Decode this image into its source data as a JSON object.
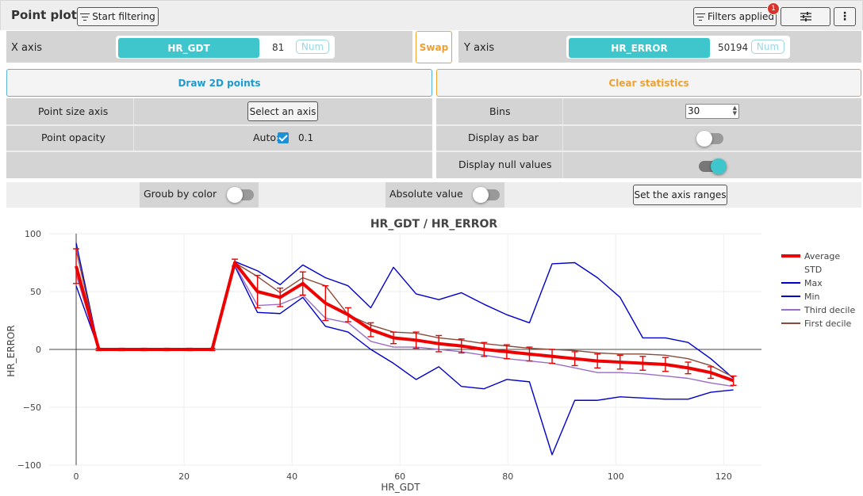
{
  "header": {
    "title": "Point plot",
    "start_filtering": "Start filtering",
    "filters_applied": "Filters applied",
    "filters_badge": "1",
    "more": "⋮"
  },
  "x_axis": {
    "label": "X axis",
    "field": "HR_GDT",
    "count": "81",
    "type": "Num"
  },
  "swap_label": "Swap",
  "y_axis": {
    "label": "Y axis",
    "field": "HR_ERROR",
    "count": "50194",
    "type": "Num"
  },
  "left_panel": {
    "draw_button": "Draw 2D points",
    "point_size_label": "Point size axis",
    "select_axis_button": "Select an axis",
    "point_opacity_label": "Point opacity",
    "auto_label": "Auto:",
    "opacity_value": "0.1"
  },
  "right_panel": {
    "clear_button": "Clear statistics",
    "bins_label": "Bins",
    "bins_value": "30",
    "display_bar_label": "Display as bar",
    "display_null_label": "Display null values"
  },
  "options": {
    "group_by_color": "Groub by color",
    "absolute_value": "Absolute value",
    "set_axis_ranges": "Set the axis ranges"
  },
  "colors": {
    "accent": "#3fc6cc",
    "swap": "#f0a030",
    "draw": "#1e9ad0",
    "average": "#ee0000",
    "extreme": "#0000cc",
    "third_decile": "#9a6ec8",
    "first_decile": "#8b4a3a"
  },
  "chart_data": {
    "type": "line",
    "title": "HR_GDT / HR_ERROR",
    "xlabel": "HR_GDT",
    "ylabel": "HR_ERROR",
    "xlim": [
      -5,
      127
    ],
    "ylim": [
      -100,
      100
    ],
    "x_ticks": [
      0,
      20,
      40,
      60,
      80,
      100,
      120
    ],
    "y_ticks": [
      -100,
      -50,
      0,
      50,
      100
    ],
    "y_tick_labels": [
      "−100",
      "−50",
      "0",
      "50",
      "100"
    ],
    "grid": true,
    "legend_position": "right",
    "x": [
      0,
      4.2,
      8.4,
      12.6,
      16.8,
      21,
      25.2,
      29.4,
      33.6,
      37.8,
      42,
      46.2,
      50.4,
      54.6,
      58.8,
      63,
      67.2,
      71.4,
      75.6,
      79.8,
      84,
      88.2,
      92.4,
      96.6,
      100.8,
      105,
      109.2,
      113.4,
      117.6,
      121.8
    ],
    "series": [
      {
        "name": "Average",
        "values": [
          72,
          0,
          0,
          0,
          0,
          0,
          0,
          75,
          50,
          45,
          57,
          40,
          30,
          17,
          10,
          8,
          5,
          3,
          0,
          -2,
          -4,
          -6,
          -8,
          -10,
          -11,
          -12,
          -13,
          -16,
          -20,
          -27
        ],
        "std": [
          15,
          1,
          1,
          1,
          1,
          1,
          1,
          3,
          14,
          8,
          10,
          15,
          6,
          6,
          5,
          7,
          7,
          6,
          6,
          6,
          6,
          6,
          6,
          6,
          6,
          6,
          6,
          5,
          5,
          4
        ]
      },
      {
        "name": "STD"
      },
      {
        "name": "Max",
        "values": [
          92,
          0,
          0,
          0,
          0,
          0,
          0,
          76,
          68,
          56,
          73,
          62,
          55,
          36,
          71,
          48,
          43,
          49,
          39,
          30,
          23,
          74,
          75,
          62,
          45,
          10,
          10,
          6,
          -8,
          -25
        ]
      },
      {
        "name": "Min",
        "values": [
          55,
          0,
          0,
          0,
          0,
          0,
          0,
          72,
          32,
          31,
          45,
          20,
          15,
          0,
          -12,
          -26,
          -15,
          -32,
          -34,
          -26,
          -28,
          -91,
          -44,
          -44,
          -41,
          -42,
          -43,
          -43,
          -37,
          -35
        ]
      },
      {
        "name": "Third decile",
        "values": [
          65,
          0,
          0,
          0,
          0,
          0,
          0,
          73,
          38,
          39,
          47,
          27,
          23,
          7,
          2,
          2,
          0,
          -2,
          -5,
          -8,
          -10,
          -12,
          -16,
          -20,
          -20,
          -21,
          -23,
          -25,
          -29,
          -32
        ]
      },
      {
        "name": "First decile",
        "values": [
          86,
          0,
          0,
          0,
          0,
          0,
          0,
          75,
          63,
          49,
          62,
          55,
          30,
          21,
          15,
          14,
          10,
          8,
          5,
          3,
          1,
          0,
          -1,
          -3,
          -4,
          -4,
          -5,
          -8,
          -14,
          -24
        ]
      }
    ]
  }
}
